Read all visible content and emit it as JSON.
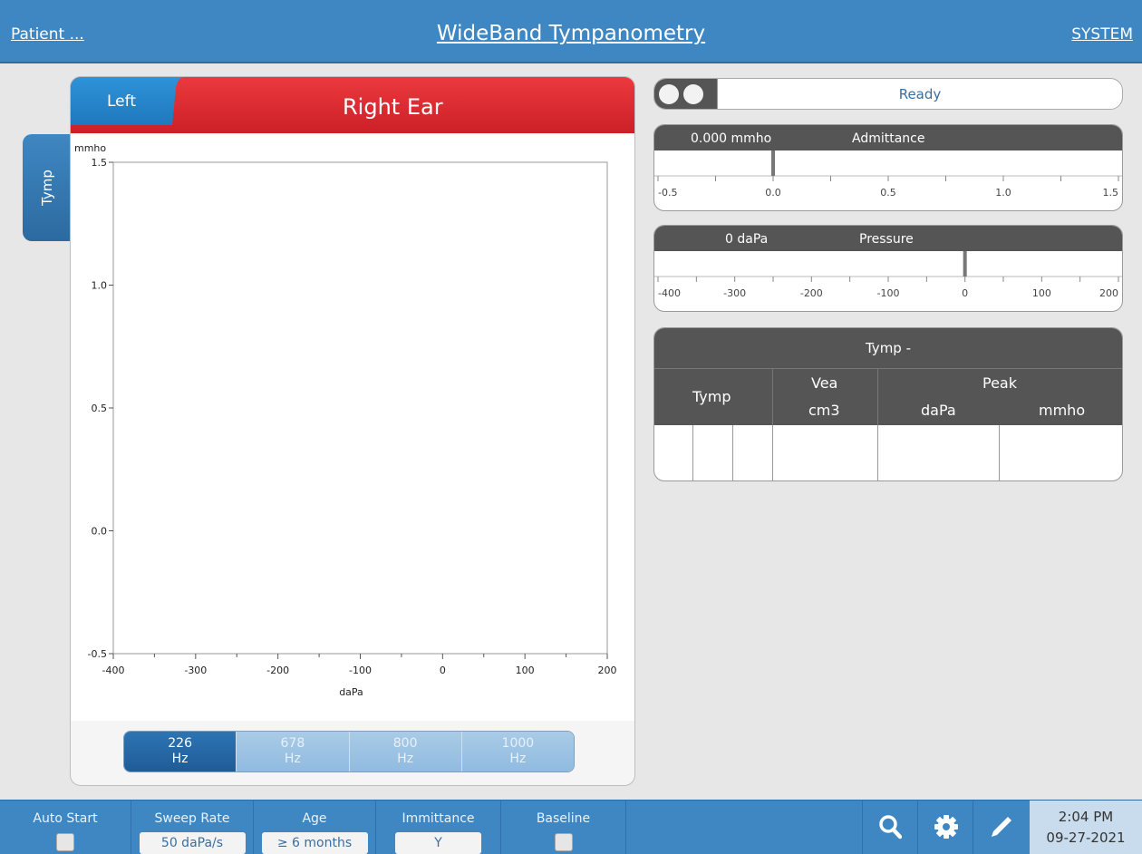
{
  "header": {
    "patient_link": "Patient ...",
    "title": "WideBand Tympanometry",
    "system_link": "SYSTEM"
  },
  "side_tab": {
    "label": "Tymp"
  },
  "ear": {
    "left_tab": "Left",
    "title": "Right Ear",
    "accent_color": "#d8262d"
  },
  "chart_data": {
    "type": "line",
    "ylabel": "mmho",
    "xlabel": "daPa",
    "xlim": [
      -400,
      200
    ],
    "ylim": [
      -0.5,
      1.5
    ],
    "x_ticks": [
      "-400",
      "-300",
      "-200",
      "-100",
      "0",
      "100",
      "200"
    ],
    "y_ticks": [
      "1.5",
      "1.0",
      "0.5",
      "0.0",
      "-0.5"
    ],
    "series": []
  },
  "frequencies": [
    {
      "value": "226",
      "unit": "Hz",
      "selected": true
    },
    {
      "value": "678",
      "unit": "Hz",
      "selected": false
    },
    {
      "value": "800",
      "unit": "Hz",
      "selected": false
    },
    {
      "value": "1000",
      "unit": "Hz",
      "selected": false
    }
  ],
  "status": {
    "text": "Ready"
  },
  "admittance_gauge": {
    "value_text": "0.000 mmho",
    "name": "Admittance",
    "value": 0.0,
    "range": [
      -0.5,
      1.5
    ],
    "tick_labels": [
      "-0.5",
      "0.0",
      "0.5",
      "1.0",
      "1.5"
    ]
  },
  "pressure_gauge": {
    "value_text": "0 daPa",
    "name": "Pressure",
    "value": 0,
    "range": [
      -400,
      200
    ],
    "tick_labels": [
      "-400",
      "-300",
      "-200",
      "-100",
      "0",
      "100",
      "200"
    ]
  },
  "results_table": {
    "title": "Tymp -",
    "col_tymp": "Tymp",
    "col_vea": "Vea",
    "col_vea_unit": "cm3",
    "col_peak": "Peak",
    "col_peak_dapa": "daPa",
    "col_peak_mmho": "mmho"
  },
  "footer": {
    "auto_start": {
      "label": "Auto Start",
      "checked": false
    },
    "sweep_rate": {
      "label": "Sweep Rate",
      "value": "50 daPa/s"
    },
    "age": {
      "label": "Age",
      "value": "≥ 6 months"
    },
    "immittance": {
      "label": "Immittance",
      "value": "Y"
    },
    "baseline": {
      "label": "Baseline",
      "checked": false
    },
    "icons": [
      "search-icon",
      "gear-icon",
      "pencil-icon"
    ],
    "time": "2:04 PM",
    "date": "09-27-2021"
  }
}
